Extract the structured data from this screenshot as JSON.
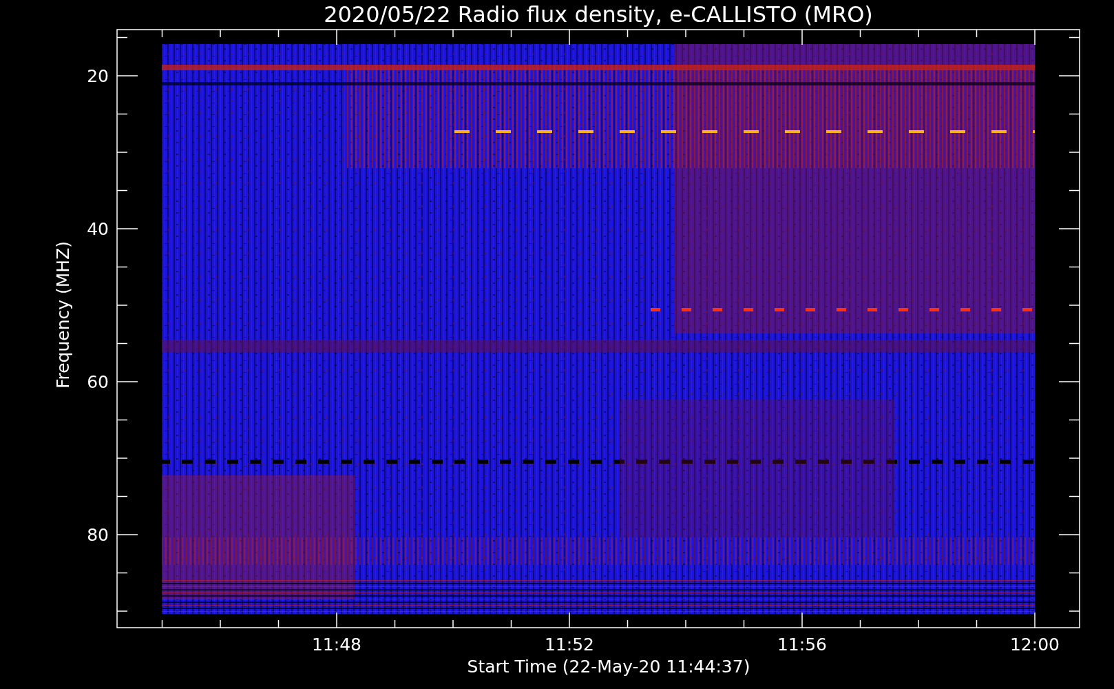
{
  "title": "2020/05/22  Radio flux density, e-CALLISTO (MRO)",
  "x_axis": {
    "label": "Start Time (22-May-20 11:44:37)",
    "ticks": [
      "11:48",
      "11:52",
      "11:56",
      "12:00"
    ]
  },
  "y_axis": {
    "label": "Frequency (MHZ)",
    "ticks": [
      "20",
      "40",
      "60",
      "80"
    ]
  }
}
